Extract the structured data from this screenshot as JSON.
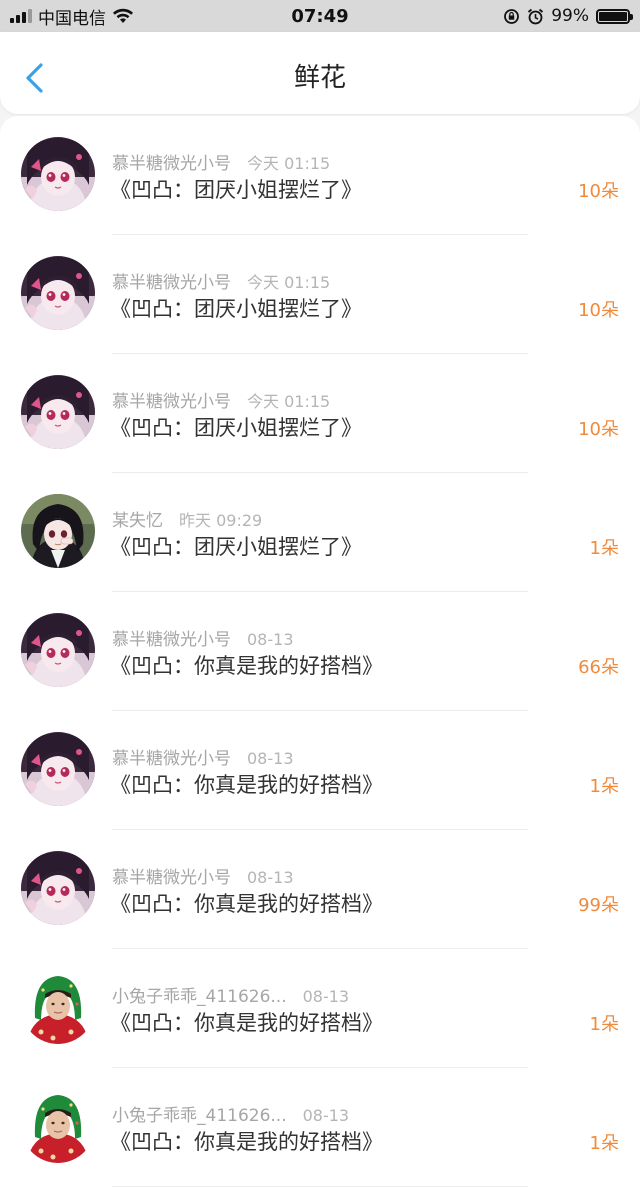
{
  "status_bar": {
    "carrier": "中国电信",
    "time": "07:49",
    "battery": "99%",
    "battery_level": 0.99
  },
  "nav": {
    "title": "鲜花",
    "back_icon": "chevron-left-icon",
    "accent": "#3aa3e8"
  },
  "colors": {
    "count": "#f08a3c"
  },
  "rows": [
    {
      "user": "慕半糖微光小号",
      "time": "今天 01:15",
      "work": "《凹凸：团厌小姐摆烂了》",
      "count": "10朵",
      "avatar": "anime-girl-pink"
    },
    {
      "user": "慕半糖微光小号",
      "time": "今天 01:15",
      "work": "《凹凸：团厌小姐摆烂了》",
      "count": "10朵",
      "avatar": "anime-girl-pink"
    },
    {
      "user": "慕半糖微光小号",
      "time": "今天 01:15",
      "work": "《凹凸：团厌小姐摆烂了》",
      "count": "10朵",
      "avatar": "anime-girl-pink"
    },
    {
      "user": "某失忆",
      "time": "昨天 09:29",
      "work": "《凹凸：团厌小姐摆烂了》",
      "count": "1朵",
      "avatar": "anime-girl-dark"
    },
    {
      "user": "慕半糖微光小号",
      "time": "08-13",
      "work": "《凹凸：你真是我的好搭档》",
      "count": "66朵",
      "avatar": "anime-girl-pink"
    },
    {
      "user": "慕半糖微光小号",
      "time": "08-13",
      "work": "《凹凸：你真是我的好搭档》",
      "count": "1朵",
      "avatar": "anime-girl-pink"
    },
    {
      "user": "慕半糖微光小号",
      "time": "08-13",
      "work": "《凹凸：你真是我的好搭档》",
      "count": "99朵",
      "avatar": "anime-girl-pink"
    },
    {
      "user": "小兔子乖乖_411626...",
      "time": "08-13",
      "work": "《凹凸：你真是我的好搭档》",
      "count": "1朵",
      "avatar": "person-green-scarf"
    },
    {
      "user": "小兔子乖乖_411626...",
      "time": "08-13",
      "work": "《凹凸：你真是我的好搭档》",
      "count": "1朵",
      "avatar": "person-green-scarf"
    }
  ]
}
